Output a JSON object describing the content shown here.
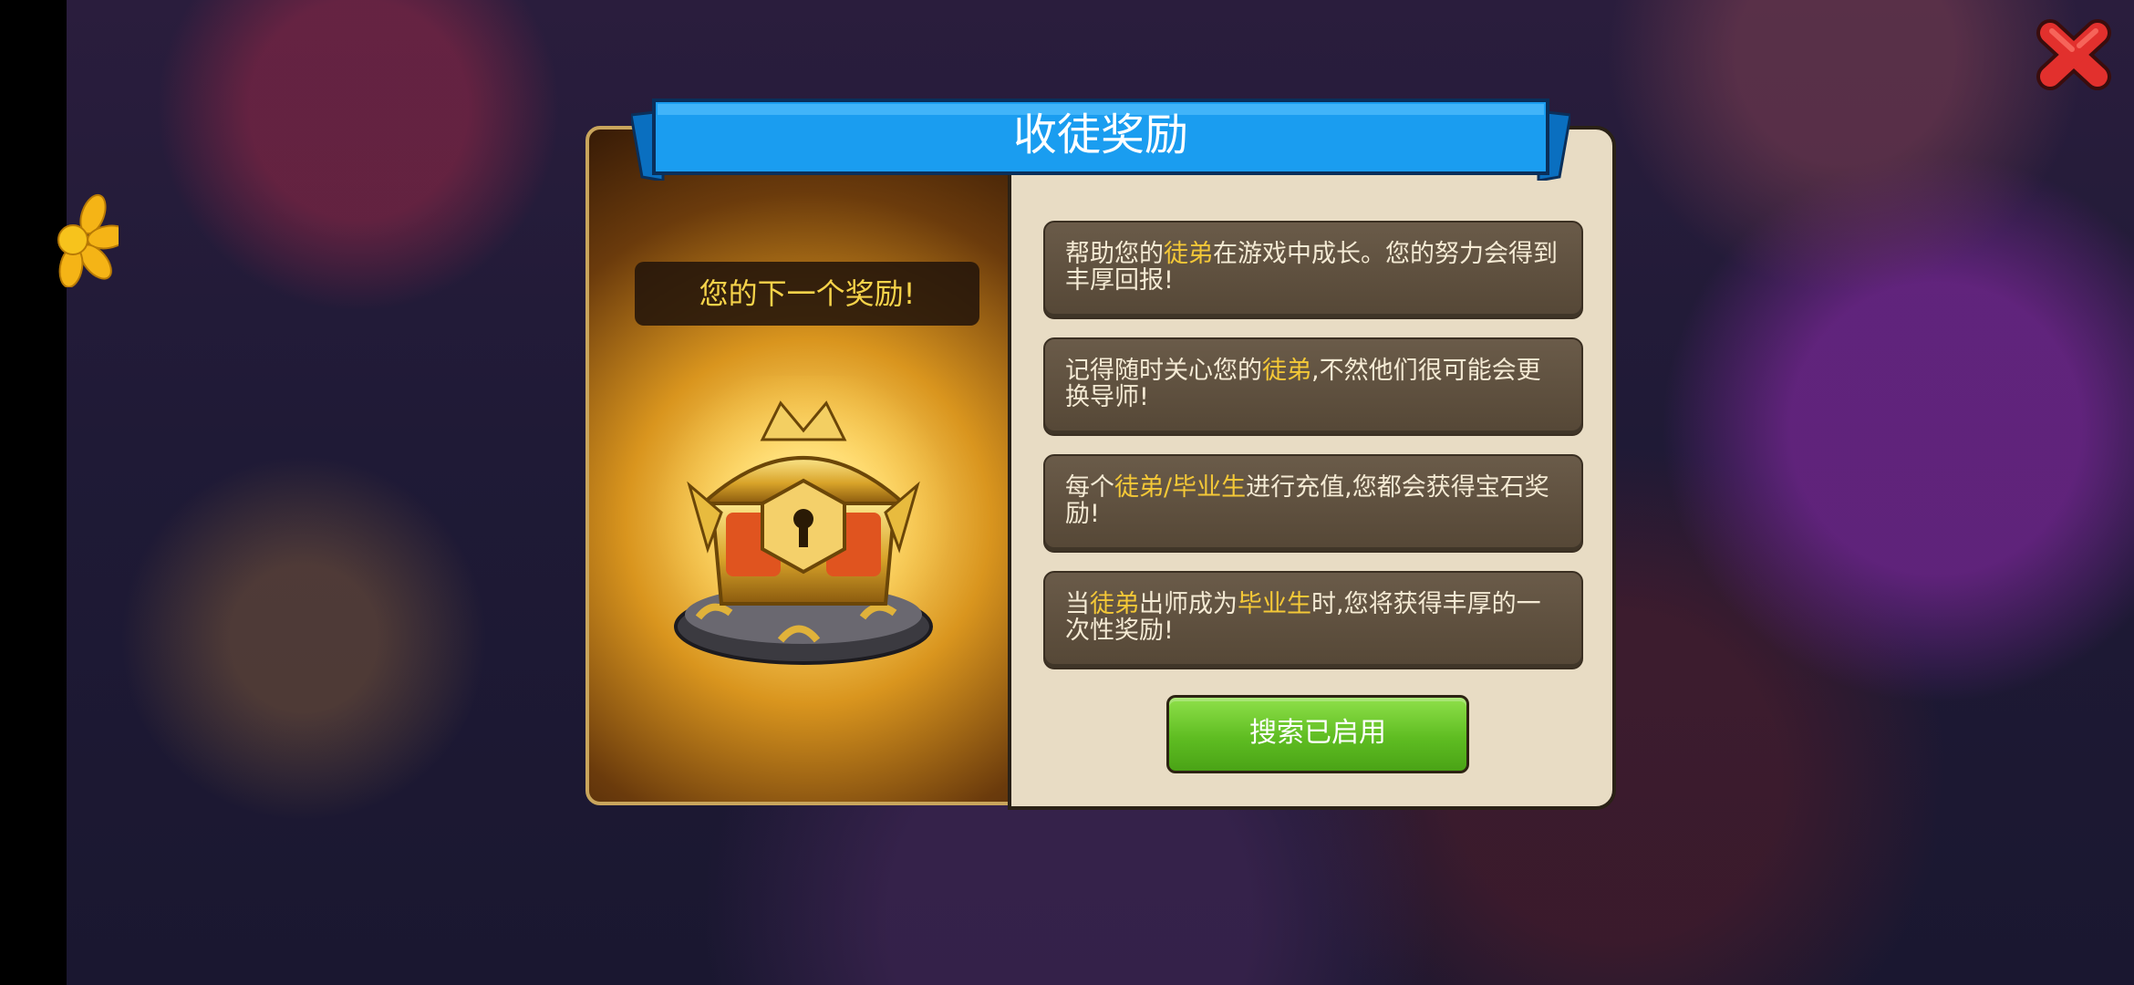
{
  "dialog": {
    "title": "收徒奖励",
    "next_reward_label": "您的下一个奖励!",
    "reward_item_icon": "golden-treasure-chest-icon",
    "info": [
      {
        "segments": [
          {
            "t": "帮助您的"
          },
          {
            "t": "徒弟",
            "hl": true
          },
          {
            "t": "在游戏中成长。您的努力会得到丰厚回报!"
          }
        ]
      },
      {
        "segments": [
          {
            "t": "记得随时关心您的"
          },
          {
            "t": "徒弟",
            "hl": true
          },
          {
            "t": ",不然他们很可能会更换导师!"
          }
        ]
      },
      {
        "segments": [
          {
            "t": "每个"
          },
          {
            "t": "徒弟/毕业生",
            "hl": true
          },
          {
            "t": "进行充值,您都会获得宝石奖励!"
          }
        ]
      },
      {
        "segments": [
          {
            "t": "当"
          },
          {
            "t": "徒弟",
            "hl": true
          },
          {
            "t": "出师成为"
          },
          {
            "t": "毕业生",
            "hl": true
          },
          {
            "t": "时,您将获得丰厚的一次性奖励!"
          }
        ]
      }
    ],
    "search_button_label": "搜索已启用"
  },
  "close_icon": "red-x-close-icon",
  "colors": {
    "highlight": "#f4c837",
    "ribbon_blue": "#1a9df0",
    "button_green": "#5fbd22",
    "close_red": "#e2302d"
  }
}
